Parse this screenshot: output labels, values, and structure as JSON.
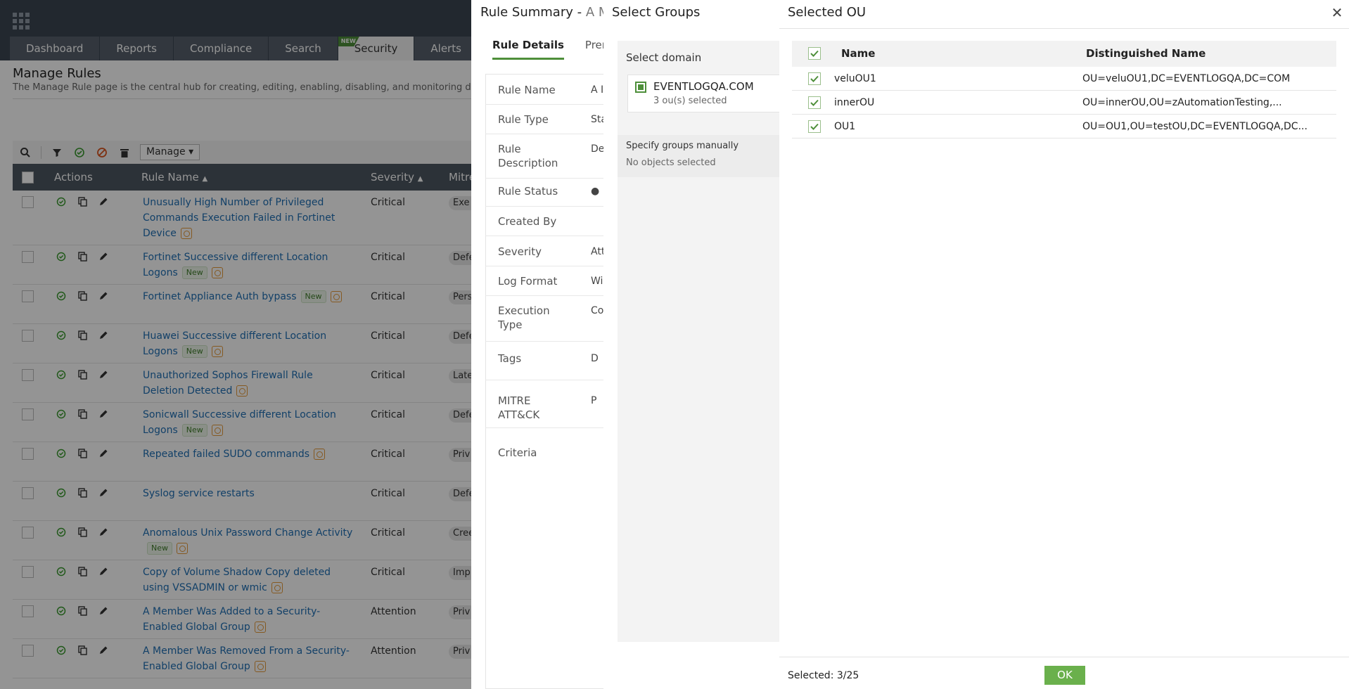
{
  "nav": {
    "tabs": [
      {
        "label": "Dashboard"
      },
      {
        "label": "Reports"
      },
      {
        "label": "Compliance"
      },
      {
        "label": "Search"
      },
      {
        "label": "Security",
        "badge": "NEW"
      },
      {
        "label": "Alerts"
      }
    ]
  },
  "page": {
    "title": "Manage Rules",
    "description": "The Manage Rule page is the central hub for creating, editing, enabling, disabling, and monitoring dete"
  },
  "toolbar": {
    "manage_label": "Manage"
  },
  "table": {
    "headers": {
      "actions": "Actions",
      "rule_name": "Rule Name",
      "severity": "Severity",
      "mitre": "Mitre"
    },
    "rows": [
      {
        "name": "Unusually High Number of Privileged Commands Execution Failed in Fortinet Device",
        "severity": "Critical",
        "mitre": "Exe",
        "new": false
      },
      {
        "name": "Fortinet Successive different Location Logons",
        "severity": "Critical",
        "mitre": "Defe",
        "new": true
      },
      {
        "name": "Fortinet Appliance Auth bypass",
        "severity": "Critical",
        "mitre": "Pers",
        "new": true
      },
      {
        "name": "Huawei Successive different Location Logons",
        "severity": "Critical",
        "mitre": "Defe",
        "new": true
      },
      {
        "name": "Unauthorized Sophos Firewall Rule Deletion Detected",
        "severity": "Critical",
        "mitre": "Late",
        "new": false
      },
      {
        "name": "Sonicwall Successive different Location Logons",
        "severity": "Critical",
        "mitre": "Defe",
        "new": true
      },
      {
        "name": "Repeated failed SUDO commands",
        "severity": "Critical",
        "mitre": "Priv",
        "new": false
      },
      {
        "name": "Syslog service restarts",
        "severity": "Critical",
        "mitre": "Defe",
        "new": false
      },
      {
        "name": "Anomalous Unix Password Change Activity",
        "severity": "Critical",
        "mitre": "Cree",
        "new": true
      },
      {
        "name": "Copy of Volume Shadow Copy deleted using VSSADMIN or wmic",
        "severity": "Critical",
        "mitre": "Imp",
        "new": false
      },
      {
        "name": "A Member Was Added to a Security-Enabled Global Group",
        "severity": "Attention",
        "mitre": "Priv",
        "new": false
      },
      {
        "name": "A Member Was Removed From a Security-Enabled Global Group",
        "severity": "Attention",
        "mitre": "Priv",
        "new": false
      }
    ],
    "new_label": "New"
  },
  "rule_summary": {
    "title": "Rule Summary",
    "subtitle": "A Mem",
    "tabs": [
      {
        "label": "Rule Details"
      },
      {
        "label": "Prere"
      }
    ],
    "fields": [
      {
        "label": "Rule Name",
        "value": "A I"
      },
      {
        "label": "Rule Type",
        "value": "Sta"
      },
      {
        "label": "Rule Description",
        "value": "De"
      },
      {
        "label": "Rule Status",
        "value": "●"
      },
      {
        "label": "Created By",
        "value": ""
      },
      {
        "label": "Severity",
        "value": "Att"
      },
      {
        "label": "Log Format",
        "value": "Wi"
      },
      {
        "label": "Execution Type",
        "value": "Co"
      },
      {
        "label": "Tags",
        "value": "D"
      },
      {
        "label": "MITRE ATT&CK",
        "value": "P"
      },
      {
        "label": "Criteria",
        "value": ""
      }
    ]
  },
  "select_groups": {
    "title": "Select Groups",
    "domain_label": "Select domain",
    "domain_name": "EVENTLOGQA.COM",
    "domain_count": "3 ou(s) selected",
    "manual_label": "Specify groups manually",
    "manual_empty": "No objects selected"
  },
  "selected_ou": {
    "title": "Selected OU",
    "headers": {
      "name": "Name",
      "dn": "Distinguished Name"
    },
    "rows": [
      {
        "name": "veluOU1",
        "dn": "OU=veluOU1,DC=EVENTLOGQA,DC=COM"
      },
      {
        "name": "innerOU",
        "dn": "OU=innerOU,OU=zAutomationTesting,..."
      },
      {
        "name": "OU1",
        "dn": "OU=OU1,OU=testOU,DC=EVENTLOGQA,DC..."
      }
    ],
    "selected_label": "Selected: 3/25",
    "ok_label": "OK"
  },
  "colors": {
    "accent": "#6ab04c",
    "link": "#1f6fb4",
    "topbar": "#3c4652"
  }
}
